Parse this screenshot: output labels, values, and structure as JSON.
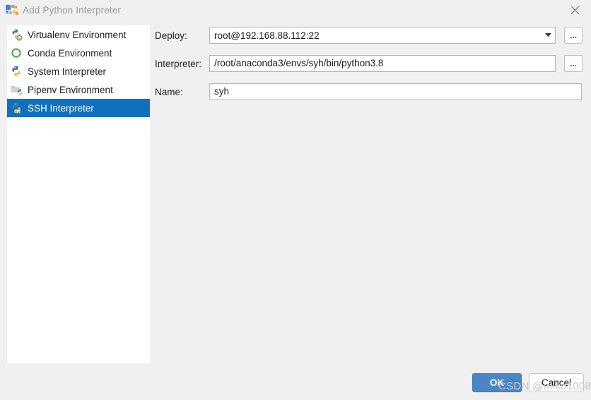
{
  "window": {
    "title": "Add Python Interpreter",
    "title_icon": "pycharm-logo-icon",
    "close_icon": "close-icon"
  },
  "sidebar": {
    "items": [
      {
        "label": "Virtualenv Environment",
        "icon": "virtualenv-python-icon",
        "selected": false
      },
      {
        "label": "Conda Environment",
        "icon": "conda-ring-icon",
        "selected": false
      },
      {
        "label": "System Interpreter",
        "icon": "python-icon",
        "selected": false
      },
      {
        "label": "Pipenv Environment",
        "icon": "pipenv-folder-icon",
        "selected": false
      },
      {
        "label": "SSH Interpreter",
        "icon": "ssh-remote-python-icon",
        "selected": true
      }
    ]
  },
  "form": {
    "deploy": {
      "label": "Deploy:",
      "value": "root@192.168.88.112:22",
      "dropdown_icon": "chevron-down-icon",
      "browse_label": "...",
      "browse_icon": "ellipsis-icon"
    },
    "interpreter": {
      "label": "Interpreter:",
      "value": "/root/anaconda3/envs/syh/bin/python3.8",
      "browse_label": "...",
      "browse_icon": "ellipsis-icon"
    },
    "name": {
      "label": "Name:",
      "value": "syh"
    }
  },
  "footer": {
    "ok_label": "OK",
    "cancel_label": "Cancel"
  },
  "watermark": {
    "text": "CSDN @miku1008"
  },
  "colors": {
    "accent": "#1070c0",
    "ok_button": "#4a86c5",
    "window_bg": "#f0f0f0",
    "field_bg": "#ffffff",
    "field_border": "#b4b4b4",
    "title_text": "#9a9a9a"
  }
}
